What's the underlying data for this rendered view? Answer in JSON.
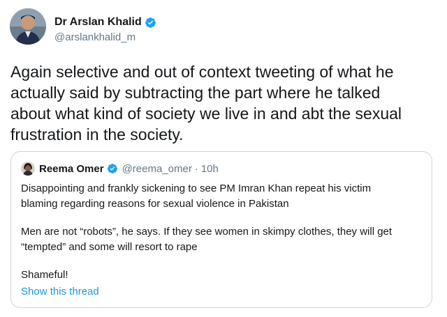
{
  "author": {
    "display_name": "Dr Arslan Khalid",
    "handle": "@arslankhalid_m",
    "verified_icon": "verified-badge-icon",
    "avatar_icon": "avatar-photo"
  },
  "tweet": {
    "text": "Again selective and out of context tweeting of what he\nactually said by subtracting the part where he talked\nabout what kind of society we live in and abt the sexual\nfrustration in the society."
  },
  "quoted_tweet": {
    "display_name": "Reema Omer",
    "handle": "@reema_omer",
    "separator": "·",
    "time": "10h",
    "paragraphs": [
      "Disappointing and frankly sickening to see PM Imran Khan repeat his victim\nblaming regarding reasons for sexual violence in Pakistan",
      "Men are not “robots”, he says. If they see women in skimpy clothes, they will get\n“tempted” and some will resort to rape",
      "Shameful!"
    ],
    "show_thread_label": "Show this thread"
  },
  "colors": {
    "text": "#14171a",
    "secondary": "#657786",
    "link": "#1b95e0",
    "verified": "#1da1f2",
    "border": "#ccd6dd"
  }
}
